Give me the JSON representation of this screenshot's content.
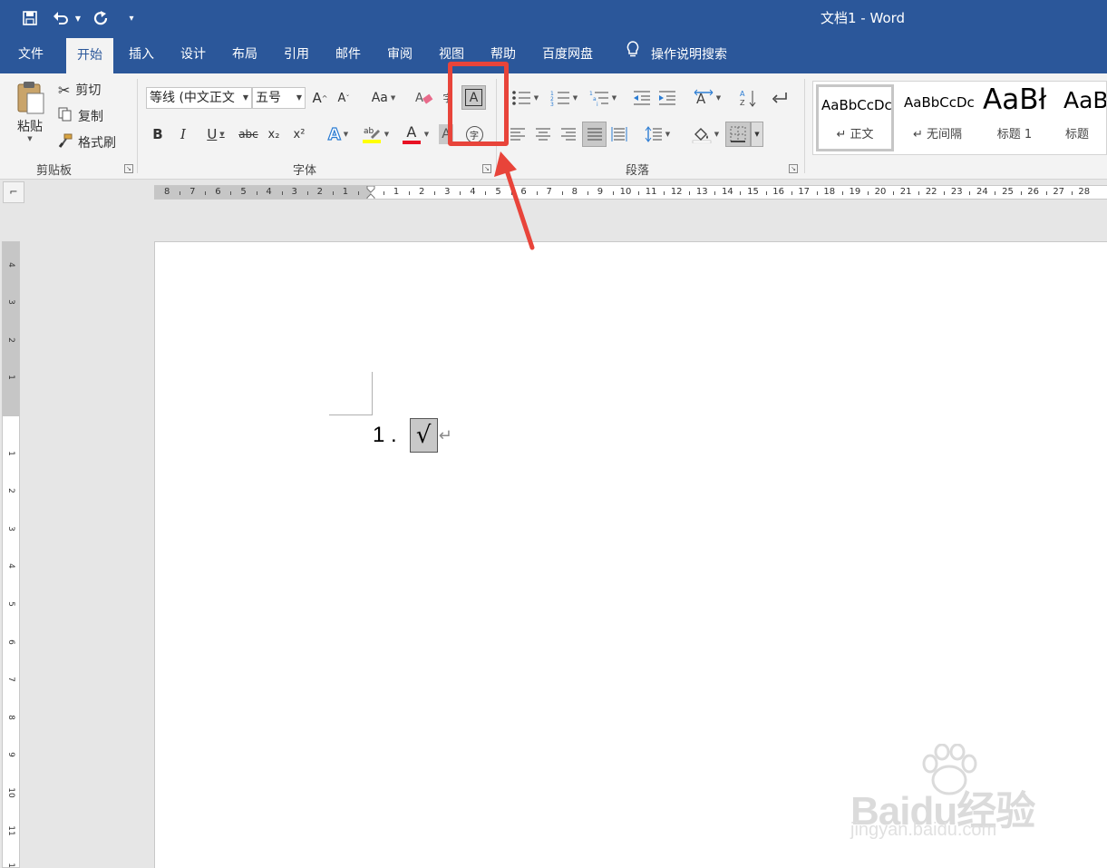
{
  "window": {
    "title": "文档1  -  Word"
  },
  "qat": {
    "save_icon": "save-icon",
    "undo_icon": "undo-icon",
    "redo_icon": "redo-icon",
    "customize_icon": "customize-qat-icon"
  },
  "tabs": [
    {
      "label": "文件"
    },
    {
      "label": "开始"
    },
    {
      "label": "插入"
    },
    {
      "label": "设计"
    },
    {
      "label": "布局"
    },
    {
      "label": "引用"
    },
    {
      "label": "邮件"
    },
    {
      "label": "审阅"
    },
    {
      "label": "视图"
    },
    {
      "label": "帮助"
    },
    {
      "label": "百度网盘"
    }
  ],
  "search": {
    "label": "操作说明搜索"
  },
  "clipboard": {
    "paste_label": "粘贴",
    "cut_label": "剪切",
    "copy_label": "复制",
    "format_painter_label": "格式刷",
    "group_label": "剪贴板"
  },
  "font": {
    "font_name": "等线 (中文正文",
    "font_size": "五号",
    "change_case": "Aa",
    "bold": "B",
    "italic": "I",
    "underline": "U",
    "strikethrough": "abc",
    "subscript": "x₂",
    "superscript": "x²",
    "font_color_letter": "A",
    "char_border_letter": "A",
    "phonetic_char": "字",
    "enclose_char": "字",
    "group_label": "字体"
  },
  "paragraph": {
    "group_label": "段落"
  },
  "styles": [
    {
      "preview": "AaBbCcDc",
      "name": "↵ 正文"
    },
    {
      "preview": "AaBbCcDc",
      "name": "↵ 无间隔"
    },
    {
      "preview": "AaBł",
      "name": "标题 1"
    },
    {
      "preview": "AaB",
      "name": "标题"
    }
  ],
  "ruler": {
    "corner": "⌐",
    "left_numbers": [
      "8",
      "7",
      "6",
      "5",
      "4",
      "3",
      "2",
      "1"
    ],
    "right_numbers": [
      "1",
      "2",
      "3",
      "4",
      "5",
      "6",
      "7",
      "8",
      "9",
      "10",
      "11",
      "12",
      "13",
      "14",
      "15",
      "16",
      "17",
      "18",
      "19",
      "20",
      "21",
      "22",
      "23",
      "24",
      "25",
      "26",
      "27",
      "28"
    ],
    "vertical_top": [
      "4",
      "3",
      "2",
      "1"
    ],
    "vertical_bottom": [
      "1",
      "2",
      "3",
      "4",
      "5",
      "6",
      "7",
      "8",
      "9",
      "10",
      "11",
      "12"
    ]
  },
  "document": {
    "list_number": "1 .",
    "check_char": "√",
    "paragraph_mark": "↵"
  },
  "watermark": {
    "logo": "Baidu经验",
    "url": "jingyan.baidu.com"
  },
  "colors": {
    "title_bar": "#2b579a",
    "ribbon": "#f3f3f3",
    "highlight": "#e8443a",
    "font_color_bar": "#e81123",
    "highlight_color_bar": "#ffff00"
  }
}
